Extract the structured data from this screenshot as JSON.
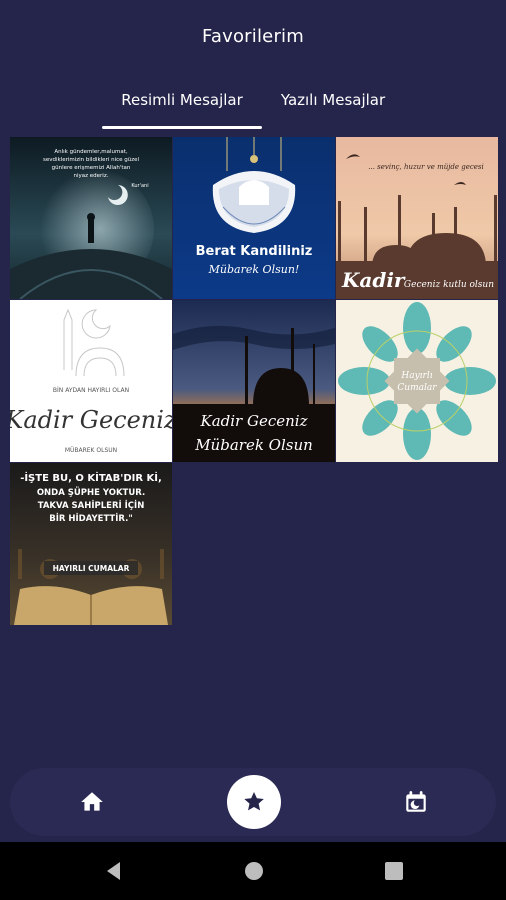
{
  "appbar": {
    "title": "Favorilerim"
  },
  "tabs": [
    {
      "label": "Resimli Mesajlar",
      "selected": true
    },
    {
      "label": "Yazılı Mesajlar",
      "selected": false
    }
  ],
  "images": {
    "tile1": {
      "caption": "Anlık gündemler,malumat, sevdiklerimizin bildikleri nice güzel günlere erişmemizi Allah'tan niyaz ederiz.",
      "sign": "Kur'ani"
    },
    "tile2": {
      "title": "Berat Kandiliniz",
      "subtitle": "Mübarek Olsun!"
    },
    "tile3": {
      "top": "... sevinç, huzur ve müjde gecesi",
      "bottom_a": "Kadir",
      "bottom_b": "Geceniz kutlu olsun"
    },
    "tile4": {
      "top": "BİN AYDAN HAYIRLI OLAN",
      "main": "Kadir Geceniz",
      "bottom": "MÜBAREK OLSUN"
    },
    "tile5": {
      "line1": "Kadir Geceniz",
      "line2": "Mübarek Olsun"
    },
    "tile6": {
      "line1": "Hayırlı",
      "line2": "Cumalar"
    },
    "tile7": {
      "line1": "-İŞTE BU, O KİTAB'DIR Kİ,",
      "line2": "ONDA ŞÜPHE YOKTUR.",
      "line3": "TAKVA SAHİPLERİ İÇİN",
      "line4": "BİR HİDAYETTİR.\"",
      "badge": "HAYIRLI CUMALAR"
    }
  },
  "bottom_nav": {
    "items": [
      {
        "icon": "home-icon",
        "active": false
      },
      {
        "icon": "star-icon",
        "active": true
      },
      {
        "icon": "calendar-moon-icon",
        "active": false
      }
    ]
  },
  "colors": {
    "background": "#25244a",
    "nav_background": "#2a2a54",
    "accent": "#ffffff"
  }
}
